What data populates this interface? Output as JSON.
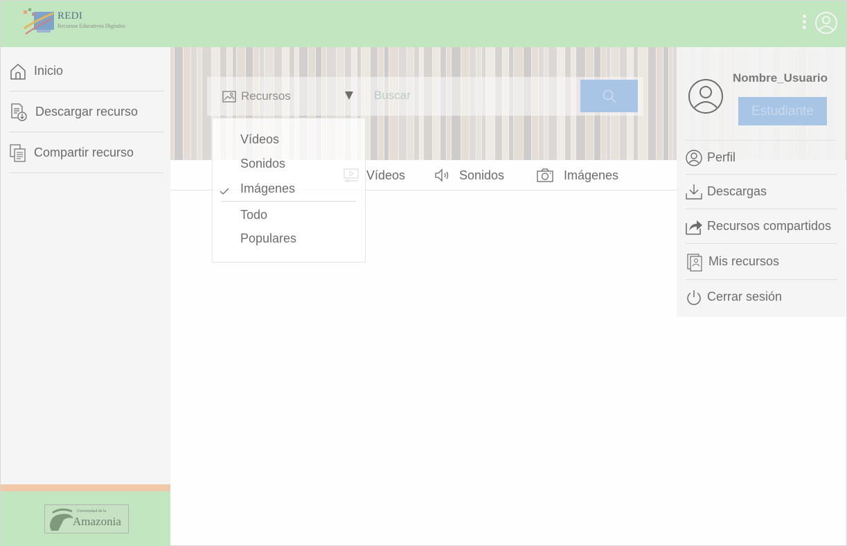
{
  "app": {
    "logo_title": "REDI",
    "logo_subtitle": "Recursos Educativos Digitales"
  },
  "topbar": {
    "menu_icon": "kebab-icon",
    "user_icon": "user-circle-icon"
  },
  "sidebar": {
    "items": [
      {
        "label": "Inicio",
        "icon": "home-icon"
      },
      {
        "label": "Descargar recurso",
        "icon": "download-file-icon"
      },
      {
        "label": "Compartir recurso",
        "icon": "share-files-icon"
      }
    ],
    "footer_logo_small": "Universidad de la",
    "footer_logo_big": "Amazonia"
  },
  "search": {
    "selected": "Recursos",
    "placeholder": "Buscar",
    "button_icon": "search-icon"
  },
  "dropdown": {
    "options": [
      "Vídeos",
      "Sonidos",
      "Imágenes",
      "Todo",
      "Populares"
    ],
    "checked": "Imágenes"
  },
  "tabs": [
    {
      "label": "Vídeos",
      "icon": "video-icon"
    },
    {
      "label": "Sonidos",
      "icon": "speaker-icon"
    },
    {
      "label": "Imágenes",
      "icon": "camera-icon"
    }
  ],
  "profile": {
    "name": "Nombre_Usuario",
    "role": "Estudiante",
    "menu": [
      {
        "label": "Perfil",
        "icon": "user-circle-icon"
      },
      {
        "label": "Descargas",
        "icon": "download-icon"
      },
      {
        "label": "Recursos compartidos",
        "icon": "share-icon"
      },
      {
        "label": "Mis recursos",
        "icon": "my-resources-icon"
      },
      {
        "label": "Cerrar sesión",
        "icon": "power-icon"
      }
    ]
  },
  "colors": {
    "header_green": "#c2e6c0",
    "accent_blue": "#a9c5e6",
    "strip_orange": "#f2c9a8",
    "sidebar_bg": "#f5f5f5"
  }
}
